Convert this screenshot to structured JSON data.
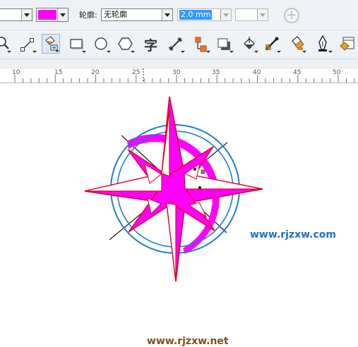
{
  "property_bar": {
    "fill_color": "#ff00ff",
    "outline_label": "轮廓:",
    "outline_style": "无轮廓",
    "outline_width": "2.0 mm",
    "add_icon": "plus-circle-icon"
  },
  "tools": [
    {
      "name": "zoom-tool",
      "icon": "magnifier-icon"
    },
    {
      "name": "connector-tool",
      "icon": "straight-line-connector-icon"
    },
    {
      "name": "smart-fill-tool",
      "icon": "smart-fill-icon"
    },
    {
      "name": "rectangle-tool",
      "icon": "rectangle-icon"
    },
    {
      "name": "ellipse-tool",
      "icon": "ellipse-icon"
    },
    {
      "name": "polygon-tool",
      "icon": "hexagon-icon"
    },
    {
      "name": "text-tool",
      "icon": "text-icon",
      "glyph": "字"
    },
    {
      "name": "dimension-tool",
      "icon": "parallel-dimension-icon"
    },
    {
      "name": "interactive-connector-tool",
      "icon": "node-connector-icon"
    },
    {
      "name": "drop-shadow-tool",
      "icon": "drop-shadow-icon"
    },
    {
      "name": "interactive-fill-tool",
      "icon": "fill-bucket-icon"
    },
    {
      "name": "eyedropper-tool",
      "icon": "eyedropper-icon"
    },
    {
      "name": "paintbucket-tool",
      "icon": "paint-bucket-icon"
    },
    {
      "name": "outline-pen-tool",
      "icon": "pen-nib-icon"
    },
    {
      "name": "object-properties-tool",
      "icon": "properties-icon"
    }
  ],
  "ruler": {
    "labels": [
      "10",
      "15",
      "20",
      "25",
      "30",
      "35",
      "40",
      "45",
      "50"
    ]
  },
  "canvas": {
    "watermark_right": "www.rjzxw.com",
    "watermark_bottom": "www.rjzxw.net",
    "colors": {
      "star_fill": "#ff00ff",
      "star_outline": "#e0001c",
      "circle_outline": "#1a7fd0",
      "guide_line": "#222222"
    }
  }
}
